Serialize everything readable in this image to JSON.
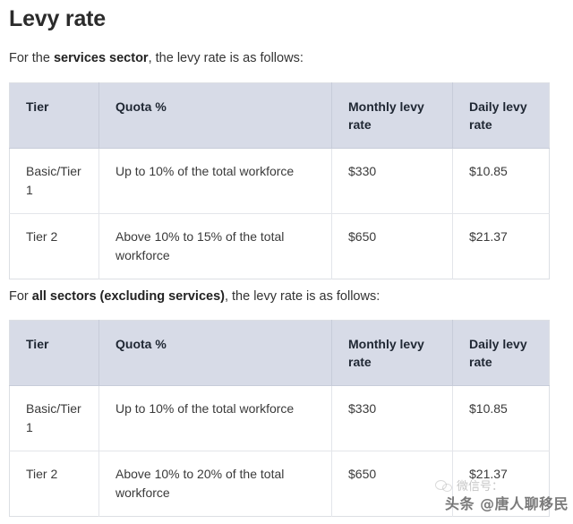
{
  "page": {
    "title": "Levy rate"
  },
  "intro_services": {
    "prefix": "For the ",
    "emphasis": "services sector",
    "suffix": ", the levy rate is as follows:"
  },
  "intro_all_sectors": {
    "prefix": "For ",
    "emphasis": "all sectors (excluding services)",
    "suffix": ", the levy rate is as follows:"
  },
  "table_services": {
    "columns": [
      "Tier",
      "Quota %",
      "Monthly levy rate",
      "Daily levy rate"
    ],
    "rows": [
      {
        "tier": "Basic/Tier 1",
        "quota": "Up to 10% of the total workforce",
        "monthly": "$330",
        "daily": "$10.85"
      },
      {
        "tier": "Tier 2",
        "quota": "Above 10% to 15% of the total workforce",
        "monthly": "$650",
        "daily": "$21.37"
      }
    ]
  },
  "table_all_sectors": {
    "columns": [
      "Tier",
      "Quota %",
      "Monthly levy rate",
      "Daily levy rate"
    ],
    "rows": [
      {
        "tier": "Basic/Tier 1",
        "quota": "Up to 10% of the total workforce",
        "monthly": "$330",
        "daily": "$10.85"
      },
      {
        "tier": "Tier 2",
        "quota": "Above 10% to 20% of the total workforce",
        "monthly": "$650",
        "daily": "$21.37"
      }
    ]
  },
  "watermarks": {
    "wechat": "微信号：",
    "toutiao": "头条 @唐人聊移民"
  },
  "colors": {
    "header_background": "#d7dbe7",
    "table_border": "#dcdfe4",
    "title_text": "#2b2b2b",
    "body_text": "#333333"
  }
}
